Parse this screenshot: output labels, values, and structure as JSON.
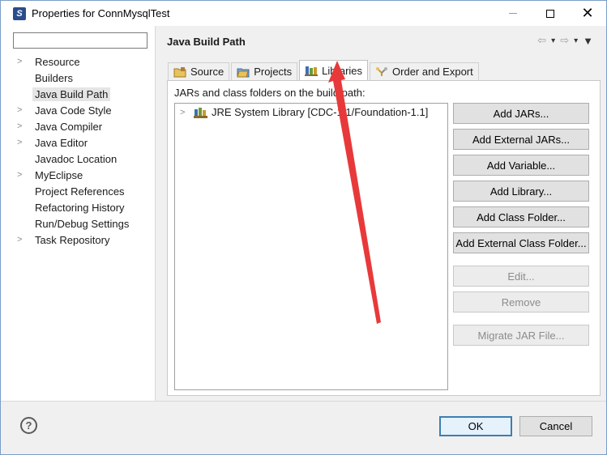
{
  "window": {
    "title": "Properties for ConnMysqlTest",
    "app_icon": "S",
    "close_glyph": "✕"
  },
  "sidebar": {
    "filter": {
      "value": "",
      "placeholder": ""
    },
    "items": [
      {
        "label": "Resource",
        "expandable": true
      },
      {
        "label": "Builders",
        "expandable": false
      },
      {
        "label": "Java Build Path",
        "expandable": false,
        "selected": true
      },
      {
        "label": "Java Code Style",
        "expandable": true
      },
      {
        "label": "Java Compiler",
        "expandable": true
      },
      {
        "label": "Java Editor",
        "expandable": true
      },
      {
        "label": "Javadoc Location",
        "expandable": false
      },
      {
        "label": "MyEclipse",
        "expandable": true
      },
      {
        "label": "Project References",
        "expandable": false
      },
      {
        "label": "Refactoring History",
        "expandable": false
      },
      {
        "label": "Run/Debug Settings",
        "expandable": false
      },
      {
        "label": "Task Repository",
        "expandable": true
      }
    ]
  },
  "main": {
    "title": "Java Build Path",
    "tabs": [
      {
        "label": "Source",
        "icon": "source-folder-icon"
      },
      {
        "label": "Projects",
        "icon": "projects-icon"
      },
      {
        "label": "Libraries",
        "icon": "libraries-icon",
        "active": true
      },
      {
        "label": "Order and Export",
        "icon": "order-export-icon"
      }
    ],
    "jars_label": "JARs and class folders on the build path:",
    "libraries": [
      {
        "label": "JRE System Library [CDC-1.1/Foundation-1.1]"
      }
    ],
    "buttons": [
      {
        "label": "Add JARs...",
        "enabled": true
      },
      {
        "label": "Add External JARs...",
        "enabled": true
      },
      {
        "label": "Add Variable...",
        "enabled": true
      },
      {
        "label": "Add Library...",
        "enabled": true
      },
      {
        "label": "Add Class Folder...",
        "enabled": true
      },
      {
        "label": "Add External Class Folder...",
        "enabled": true
      },
      {
        "label": "Edit...",
        "enabled": false
      },
      {
        "label": "Remove",
        "enabled": false
      },
      {
        "label": "Migrate JAR File...",
        "enabled": false
      }
    ]
  },
  "footer": {
    "help": "?",
    "ok_label": "OK",
    "cancel_label": "Cancel"
  },
  "colors": {
    "annotation_arrow": "#e8393a",
    "default_button_border": "#3c7fb1"
  }
}
